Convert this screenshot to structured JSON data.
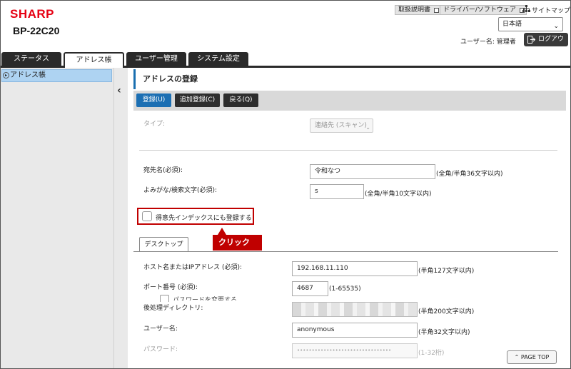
{
  "header": {
    "brand": "SHARP",
    "model": "BP-22C20",
    "links": {
      "manual": "取扱説明書",
      "driver": "ドライバー/ソフトウェア",
      "sitemap": "サイトマップ"
    },
    "language": "日本語",
    "user_label": "ユーザー名: 管理者",
    "logout": "ログアウト"
  },
  "tabs": [
    {
      "label": "ステータス",
      "active": false
    },
    {
      "label": "アドレス帳",
      "active": true
    },
    {
      "label": "ユーザー管理",
      "active": false
    },
    {
      "label": "システム設定",
      "active": false
    }
  ],
  "sidebar": {
    "items": [
      {
        "label": "アドレス帳",
        "selected": true
      }
    ]
  },
  "main": {
    "title": "アドレスの登録",
    "buttons": {
      "register": "登録(U)",
      "add_register": "追加登録(C)",
      "back": "戻る(Q)"
    },
    "type_label": "タイプ:",
    "type_value": "連絡先 (スキャン)",
    "name_label": "宛先名(必須):",
    "name_value": "令和なつ",
    "name_hint": "(全角/半角36文字以内)",
    "reading_label": "よみがな/検索文字(必須):",
    "reading_value": "s",
    "reading_hint": "(全角/半角10文字以内)",
    "frequent_label": "得意先インデックスにも登録する",
    "frequent_checked": false,
    "callout": "クリック",
    "subtab": "デスクトップ",
    "host_label": "ホスト名またはIPアドレス (必須):",
    "host_value": "192.168.11.110",
    "host_hint": "(半角127文字以内)",
    "port_label": "ポート番号 (必須):",
    "port_value": "4687",
    "port_hint": "(1-65535)",
    "dir_label": "後処理ディレクトリ:",
    "dir_hint": "(半角200文字以内)",
    "user_label": "ユーザー名:",
    "user_value": "anonymous",
    "user_hint": "(半角32文字以内)",
    "pass_label": "パスワード:",
    "pass_value": "••••••••••••••••••••••••••••••••",
    "pass_hint": "(1-32桁)",
    "change_pass_label": "パスワードを変更する",
    "page_top": "PAGE TOP"
  },
  "colors": {
    "accent": "#1c6fb3",
    "brand": "#e60012",
    "highlight": "#c00000",
    "selected": "#aed3f2"
  }
}
